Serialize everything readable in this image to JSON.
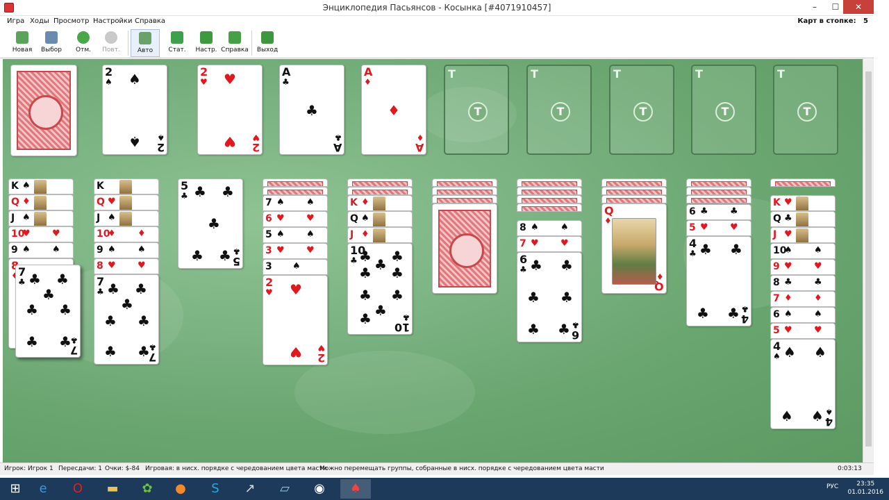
{
  "window": {
    "title": "Энциклопедия Пасьянсов  -  Косынка [#4071910457]",
    "min": "–",
    "max": "☐",
    "close": "✕"
  },
  "menu": {
    "items": [
      "Игра",
      "Ходы",
      "Просмотр",
      "Настройки",
      "Справка"
    ],
    "deck_label": "Карт в стопке:",
    "deck_count": "5"
  },
  "toolbar": {
    "buttons": [
      "Новая",
      "Выбор",
      "Отм.",
      "Повт.",
      "Авто",
      "Стат.",
      "Настр.",
      "Справка",
      "Выход"
    ]
  },
  "foundation": {
    "slot_letter": "Т"
  },
  "cards": {
    "waste1": {
      "rank": "2",
      "suit": "♠"
    },
    "waste2": {
      "rank": "2",
      "suit": "♥"
    },
    "waste3": {
      "rank": "A",
      "suit": "♣"
    },
    "waste4": {
      "rank": "A",
      "suit": "♦"
    },
    "col1": [
      "K",
      "Q",
      "J",
      "10",
      "9",
      "8"
    ],
    "col1_top": {
      "rank": "7",
      "suit": "♣"
    },
    "col2": [
      "K",
      "Q",
      "J",
      "10",
      "9",
      "8"
    ],
    "col2_top": {
      "rank": "7",
      "suit": "♣"
    },
    "col3_top": {
      "rank": "5",
      "suit": "♣"
    },
    "col4": [
      "7",
      "6",
      "5",
      "3"
    ],
    "col4_top": {
      "rank": "2",
      "suit": "♥"
    },
    "col5": [
      "K",
      "Q",
      "J"
    ],
    "col5_top": {
      "rank": "10",
      "suit": "♣"
    },
    "col7": [
      "8",
      "7"
    ],
    "col7_top": {
      "rank": "6",
      "suit": "♣"
    },
    "col8_top": {
      "rank": "Q",
      "suit": "♦"
    },
    "col9": [
      "6",
      "5"
    ],
    "col9_top": {
      "rank": "4",
      "suit": "♣"
    },
    "col10": [
      "K",
      "Q",
      "J",
      "10",
      "9",
      "8",
      "7",
      "6",
      "5"
    ],
    "col10_top": {
      "rank": "4",
      "suit": "♠"
    }
  },
  "status": {
    "player": "Игрок: Игрок 1",
    "redeals": "Пересдачи: 1",
    "score": "Очки: $-84",
    "play_rule": "Игровая: в нисх. порядке с чередованием цвета масти",
    "move_rule": "Можно перемещать группы, собранные в нисх. порядке с чередованием цвета масти",
    "time": "0:03:13"
  },
  "taskbar": {
    "lang": "РУС",
    "time": "23:35",
    "date": "01.01.2016"
  },
  "colors": {
    "felt": "#7ab281",
    "red": "#e0191e",
    "taskbar": "#1e3a5a"
  }
}
